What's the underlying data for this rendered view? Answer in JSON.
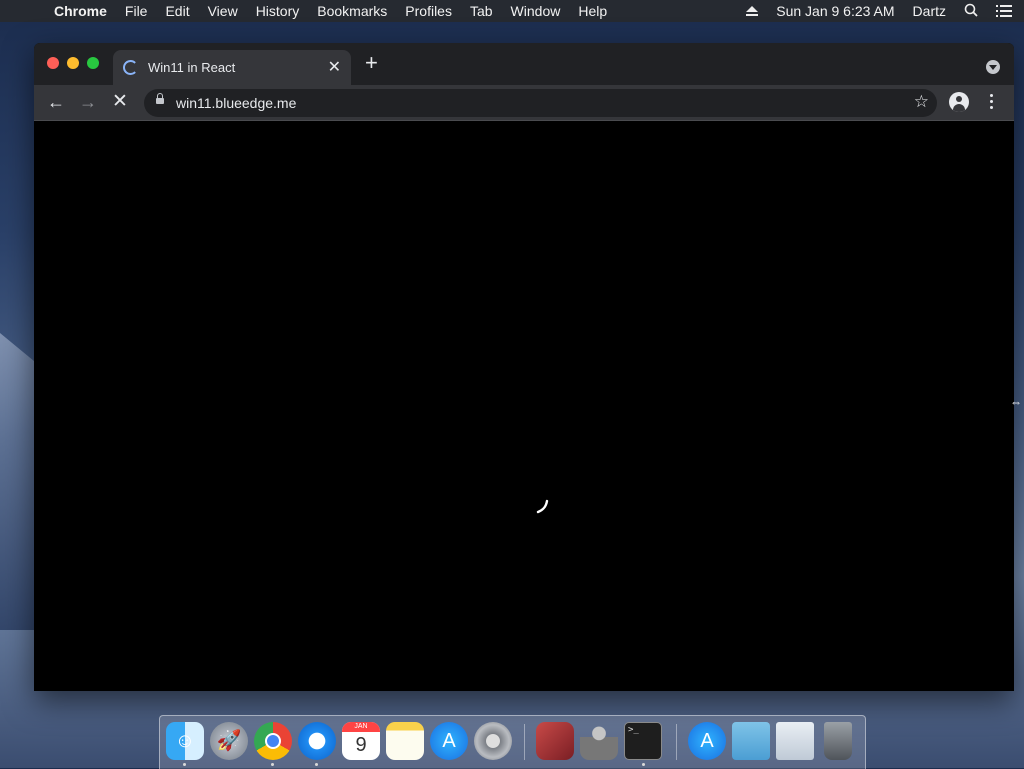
{
  "menubar": {
    "apple_icon": "apple-icon",
    "items": [
      "Chrome",
      "File",
      "Edit",
      "View",
      "History",
      "Bookmarks",
      "Profiles",
      "Tab",
      "Window",
      "Help"
    ],
    "date_time": "Sun Jan 9  6:23 AM",
    "user": "Dartz"
  },
  "browser": {
    "tab_title": "Win11 in React",
    "tab_close_glyph": "✕",
    "new_tab_glyph": "+",
    "url": "win11.blueedge.me",
    "nav": {
      "back": "←",
      "forward": "→",
      "stop": "✕"
    },
    "star_glyph": "☆"
  },
  "dock": {
    "calendar_month": "JAN",
    "calendar_day": "9",
    "terminal_prompt": ">_"
  },
  "colors": {
    "menubar": "#262a31",
    "tabstrip": "#202124",
    "toolbar": "#35363a",
    "omnibox": "#202124",
    "close": "#fe5f57",
    "minimize": "#febc2e",
    "maximize": "#28c840",
    "spinner": "#8ab4f8"
  }
}
